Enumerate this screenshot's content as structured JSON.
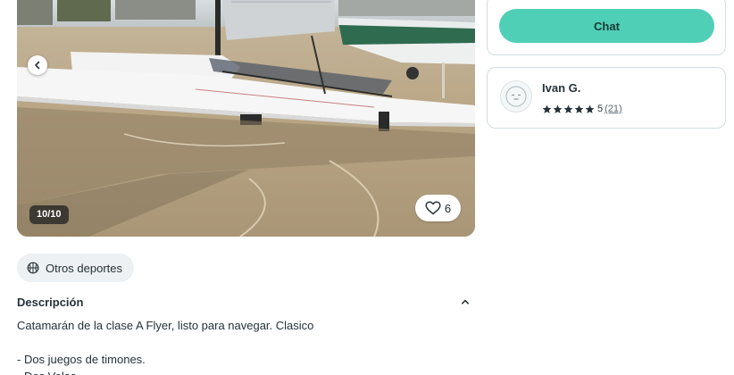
{
  "gallery": {
    "counter": "10/10",
    "favorites_count": "6"
  },
  "category": {
    "label": "Otros deportes",
    "icon": "basketball-icon"
  },
  "description": {
    "title": "Descripción",
    "lines": [
      "Catamarán de la clase A Flyer, listo para navegar. Clasico",
      "",
      "- Dos juegos de timones.",
      "- Dos Velas"
    ]
  },
  "actions": {
    "chat_label": "Chat"
  },
  "seller": {
    "name": "Ivan G.",
    "rating": 5,
    "rating_text": "5",
    "review_count": "(21)"
  },
  "colors": {
    "primary": "#4fcfb6",
    "text": "#253238",
    "border": "#d3dde0",
    "chip_bg": "#eef1f3"
  }
}
